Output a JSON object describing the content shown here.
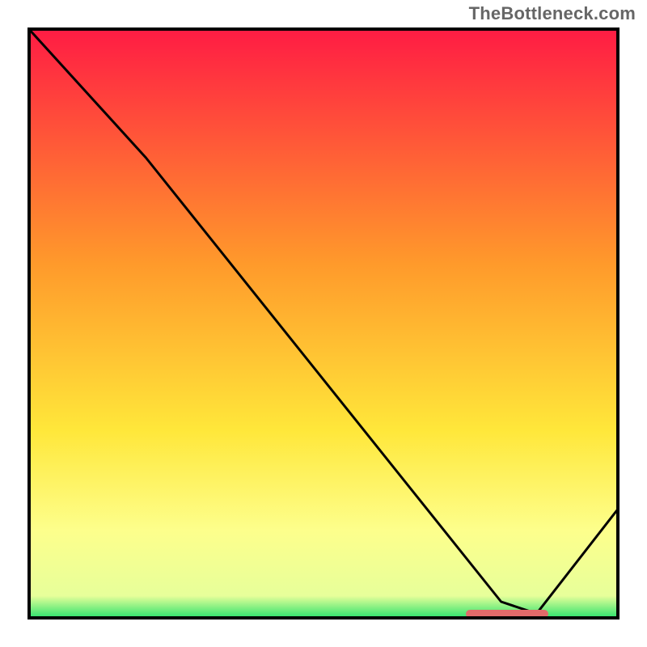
{
  "watermark": {
    "text": "TheBottleneck.com"
  },
  "colors": {
    "gradient_top": "#ff1b44",
    "gradient_mid1": "#ff9a2b",
    "gradient_mid2": "#ffe73a",
    "gradient_mid3": "#fdff8c",
    "gradient_bottom": "#1fe06a",
    "curve": "#000000",
    "frame": "#000000",
    "marker": "#e26a6a"
  },
  "chart_data": {
    "type": "line",
    "title": "",
    "xlabel": "",
    "ylabel": "",
    "xlim": [
      0,
      100
    ],
    "ylim": [
      0,
      100
    ],
    "series": [
      {
        "name": "bottleneck-curve",
        "x": [
          0,
          20,
          80,
          86,
          100
        ],
        "values": [
          100,
          78,
          3,
          1,
          19
        ]
      }
    ],
    "annotations": [
      {
        "name": "optimal-range-marker",
        "x_start": 74,
        "x_end": 88,
        "y": 1
      }
    ],
    "gradient_stops_pct": [
      0,
      40,
      68,
      85,
      96,
      100
    ],
    "legend": false,
    "grid": false
  }
}
